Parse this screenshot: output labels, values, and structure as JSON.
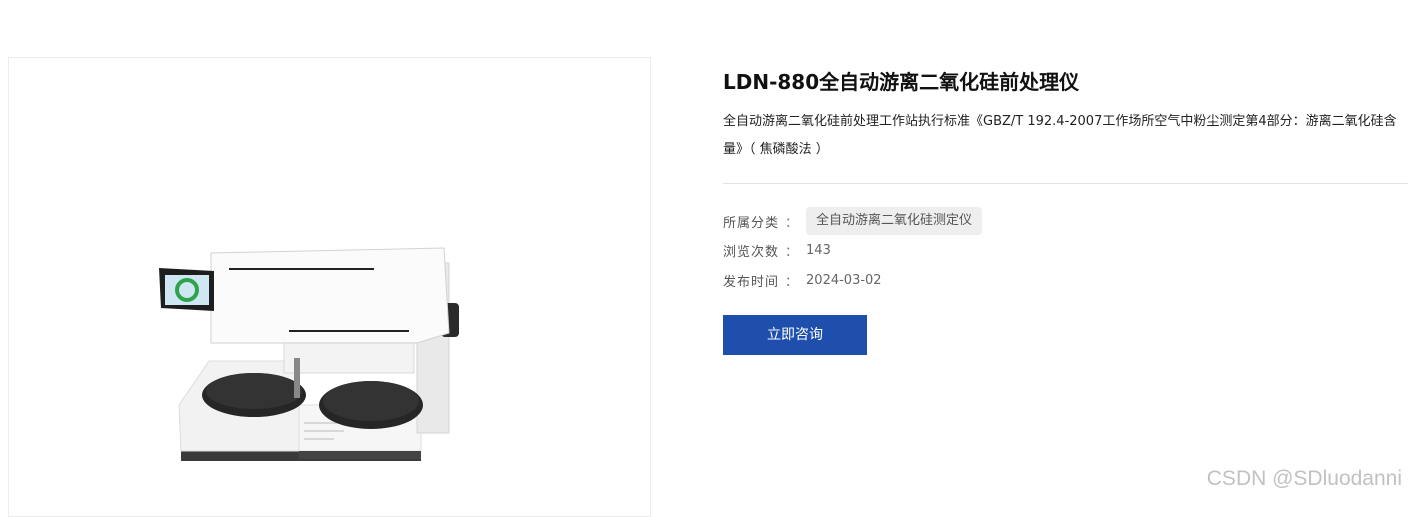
{
  "product": {
    "title": "LDN-880全自动游离二氧化硅前处理仪",
    "description": "全自动游离二氧化硅前处理工作站执行标准《GBZ/T 192.4-2007工作场所空气中粉尘测定第4部分：游离二氧化硅含量》（ 焦磷酸法 ）",
    "image_icon": "lab-instrument-image"
  },
  "meta": {
    "category_label": "所属分类",
    "category_value": "全自动游离二氧化硅测定仪",
    "views_label": "浏览次数",
    "views_value": "143",
    "date_label": "发布时间",
    "date_value": "2024-03-02",
    "separator": "："
  },
  "actions": {
    "consult_label": "立即咨询"
  },
  "watermark": {
    "text": "CSDN @SDluodanni"
  },
  "colors": {
    "accent": "#1f4fad",
    "tag_bg": "#eeeeee",
    "divider": "#e3e3e3"
  }
}
